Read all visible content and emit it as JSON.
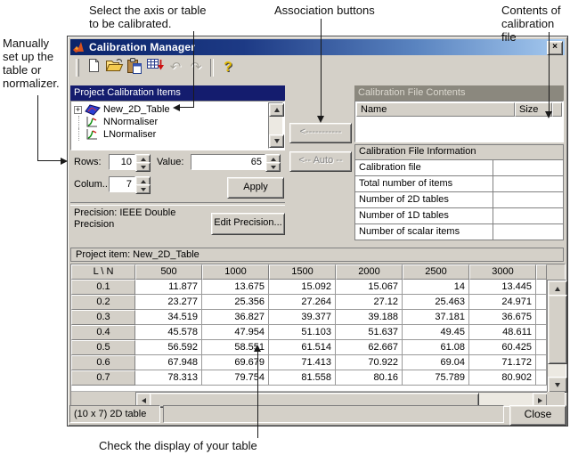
{
  "annotations": {
    "select_axis": "Select the axis or table\nto be calibrated.",
    "association": "Association buttons",
    "contents": "Contents of\ncalibration file",
    "manual": "Manually\nset up the\ntable or\nnormalizer.",
    "check_display": "Check the display of your table"
  },
  "window": {
    "title": "Calibration Manager",
    "icons": {
      "close": "×",
      "tree_expand": "+"
    },
    "toolbar": {
      "buttons": [
        "new-document-icon",
        "open-file-icon",
        "paste-icon",
        "import-table-icon",
        "undo-icon",
        "redo-icon",
        "separator",
        "help-icon"
      ],
      "disabled": [
        "undo-icon",
        "redo-icon"
      ]
    },
    "tree": {
      "header": "Project Calibration Items",
      "items": [
        {
          "label": "New_2D_Table",
          "icon": "table-2d-icon",
          "expandable": true
        },
        {
          "label": "NNormaliser",
          "icon": "normaliser-icon",
          "expandable": false
        },
        {
          "label": "LNormaliser",
          "icon": "normaliser-icon",
          "expandable": false
        }
      ]
    },
    "size_fields": {
      "rows_label": "Rows:",
      "rows_value": "10",
      "value_label": "Value:",
      "value_value": "65",
      "columns_label": "Colum..",
      "columns_value": "7",
      "apply_label": "Apply"
    },
    "precision": {
      "text": "Precision: IEEE Double\nPrecision",
      "edit_label": "Edit Precision..."
    },
    "association": {
      "assign_label": "<-----------",
      "auto_label": "<-- Auto --"
    },
    "file_contents": {
      "header": "Calibration File Contents",
      "name_col": "Name",
      "size_col": "Size"
    },
    "file_info": {
      "header": "Calibration File Information",
      "rows": [
        "Calibration file",
        "Total number of items",
        "Number of 2D tables",
        "Number of 1D tables",
        "Number of scalar items"
      ]
    },
    "project_item_label": "Project item: New_2D_Table",
    "grid": {
      "corner": "L \\ N",
      "columns": [
        "500",
        "1000",
        "1500",
        "2000",
        "2500",
        "3000"
      ],
      "rows": [
        {
          "header": "0.1",
          "values": [
            "11.877",
            "13.675",
            "15.092",
            "15.067",
            "14",
            "13.445"
          ]
        },
        {
          "header": "0.2",
          "values": [
            "23.277",
            "25.356",
            "27.264",
            "27.12",
            "25.463",
            "24.971"
          ]
        },
        {
          "header": "0.3",
          "values": [
            "34.519",
            "36.827",
            "39.377",
            "39.188",
            "37.181",
            "36.675"
          ]
        },
        {
          "header": "0.4",
          "values": [
            "45.578",
            "47.954",
            "51.103",
            "51.637",
            "49.45",
            "48.611"
          ]
        },
        {
          "header": "0.5",
          "values": [
            "56.592",
            "58.551",
            "61.514",
            "62.667",
            "61.08",
            "60.425"
          ]
        },
        {
          "header": "0.6",
          "values": [
            "67.948",
            "69.679",
            "71.413",
            "70.922",
            "69.04",
            "71.172"
          ]
        },
        {
          "header": "0.7",
          "values": [
            "78.313",
            "79.754",
            "81.558",
            "80.16",
            "75.789",
            "80.902"
          ]
        }
      ]
    },
    "status": {
      "text": "(10 x 7) 2D table",
      "close_label": "Close"
    },
    "colors": {
      "window_bg": "#d4d0c8",
      "titlebar_start": "#0a246a",
      "titlebar_end": "#a6caf0",
      "tree_header_bg": "#141c6e",
      "inactive_header_bg": "#8b887e"
    }
  }
}
